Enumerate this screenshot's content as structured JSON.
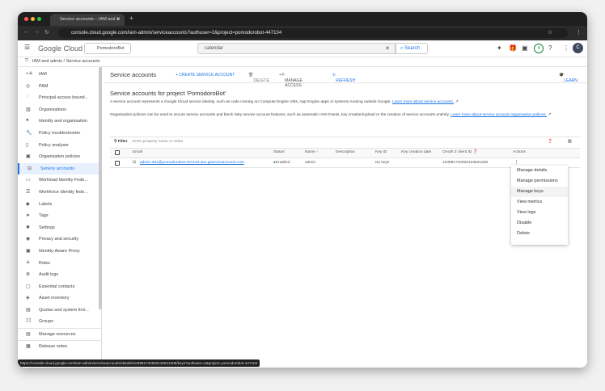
{
  "browser": {
    "tab_title": "Service accounts – IAM and a",
    "url": "console.cloud.google.com/iam-admin/serviceaccounts?authuser=2&project=pomodorobot-447104"
  },
  "header": {
    "logo": "Google Cloud",
    "project": "PomodoroBot",
    "search_value": "calendar",
    "search_button": "Search",
    "notifications": "4",
    "avatar": "C"
  },
  "breadcrumb": {
    "root": "IAM and admin",
    "sep": "/",
    "current": "Service accounts"
  },
  "sidebar": {
    "items": [
      {
        "label": "IAM",
        "icon": "+≗"
      },
      {
        "label": "PAM",
        "icon": "◎"
      },
      {
        "label": "Principal access bound...",
        "icon": "◌"
      },
      {
        "label": "Organisations",
        "icon": "▥"
      },
      {
        "label": "Identity and organisation",
        "icon": "●"
      },
      {
        "label": "Policy troubleshooter",
        "icon": "🔧"
      },
      {
        "label": "Policy analyser",
        "icon": "▯"
      },
      {
        "label": "Organisation policies",
        "icon": "▣"
      },
      {
        "label": "Service accounts",
        "icon": "⊟",
        "active": true
      },
      {
        "label": "Workload Identity Fede...",
        "icon": "▭"
      },
      {
        "label": "Workforce identity fede...",
        "icon": "☰"
      },
      {
        "label": "Labels",
        "icon": "◆"
      },
      {
        "label": "Tags",
        "icon": "➤"
      },
      {
        "label": "Settings",
        "icon": "✹"
      },
      {
        "label": "Privacy and security",
        "icon": "◉"
      },
      {
        "label": "Identity-Aware Proxy",
        "icon": "▣"
      },
      {
        "label": "Roles",
        "icon": "≗"
      },
      {
        "label": "Audit logs",
        "icon": "≣"
      },
      {
        "label": "Essential contacts",
        "icon": "▢"
      },
      {
        "label": "Asset inventory",
        "icon": "◈"
      },
      {
        "label": "Quotas and system limi...",
        "icon": "▤"
      },
      {
        "label": "Groups",
        "icon": "‡‡"
      }
    ],
    "manage_resources": "Manage resources",
    "release_notes": "Release notes"
  },
  "toolbar": {
    "title": "Service accounts",
    "create": "+ CREATE SERVICE ACCOUNT",
    "delete": "DELETE",
    "manage_access": "MANAGE ACCESS",
    "refresh": "REFRESH",
    "learn": "LEARN"
  },
  "content": {
    "heading": "Service accounts for project 'PomodoroBot'",
    "p1": "A service account represents a Google Cloud service identity, such as code running on Compute Engine VMs, App Engine apps or systems running outside Google.",
    "p1_link": "Learn more about service accounts.",
    "p2": "Organisation policies can be used to secure service accounts and block risky service account features, such as automatic IAM Grants, key creation/upload or the creation of service accounts entirely.",
    "p2_link": "Learn more about service account organisation policies."
  },
  "table": {
    "filter_label": "Filter",
    "filter_placeholder": "Enter property name or value",
    "columns": [
      "Email",
      "Status",
      "Name",
      "Description",
      "Key ID",
      "Key creation date",
      "OAuth 2 client ID",
      "Actions"
    ],
    "rows": [
      {
        "email": "admin-291@pomodorobot-447104.iam.gserviceaccount.com",
        "status": "Enabled",
        "name": "admin",
        "description": "",
        "key_id": "No keys",
        "key_date": "",
        "client_id": "103991732920133841308"
      }
    ]
  },
  "actions_menu": [
    "Manage details",
    "Manage permissions",
    "Manage keys",
    "View metrics",
    "View logs",
    "Disable",
    "Delete"
  ],
  "status_bar": "https://console.cloud.google.com/iam-admin/serviceaccounts/details/103991732920133841308/keys?authuser=2&project=pomodorobot-447104",
  "colors": {
    "accent": "#1a73e8",
    "enabled": "#188038"
  }
}
